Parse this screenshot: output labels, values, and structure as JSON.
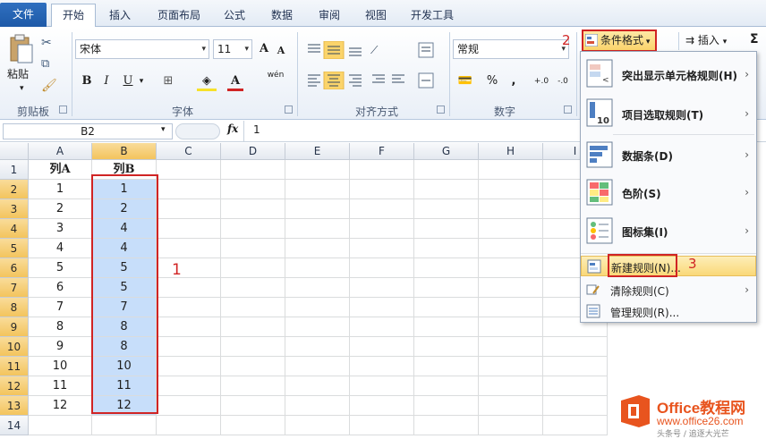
{
  "tabs": [
    "文件",
    "开始",
    "插入",
    "页面布局",
    "公式",
    "数据",
    "审阅",
    "视图",
    "开发工具"
  ],
  "clipboard": {
    "paste": "粘贴",
    "group": "剪贴板"
  },
  "font": {
    "name": "宋体",
    "size": "11",
    "group": "字体",
    "bold": "B",
    "italic": "I",
    "underline": "U",
    "grow": "A",
    "shrink": "A",
    "color_a": "A",
    "wen": "wén"
  },
  "align": {
    "group": "对齐方式"
  },
  "number": {
    "format": "常规",
    "group": "数字",
    "pct": "%",
    "comma": ",",
    "inc": "+.0",
    "dec": "-.0"
  },
  "styles": {
    "cond_format": "条件格式",
    "insert": "插入",
    "sigma": "Σ"
  },
  "formula_bar": {
    "namebox": "B2",
    "fx": "fx",
    "value": "1"
  },
  "columns": [
    "A",
    "B",
    "C",
    "D",
    "E",
    "F",
    "G",
    "H",
    "I"
  ],
  "rows": [
    "1",
    "2",
    "3",
    "4",
    "5",
    "6",
    "7",
    "8",
    "9",
    "10",
    "11",
    "12",
    "13",
    "14"
  ],
  "headers": {
    "a": "列A",
    "b": "列B"
  },
  "col_a": [
    "1",
    "2",
    "3",
    "4",
    "5",
    "6",
    "7",
    "8",
    "9",
    "10",
    "11",
    "12"
  ],
  "col_b": [
    "1",
    "2",
    "4",
    "4",
    "5",
    "5",
    "7",
    "8",
    "8",
    "10",
    "11",
    "12"
  ],
  "menu": {
    "items": [
      {
        "label": "突出显示单元格规则(H)",
        "icon": "highlight-rules-icon"
      },
      {
        "label": "项目选取规则(T)",
        "icon": "top-bottom-rules-icon"
      },
      {
        "label": "数据条(D)",
        "icon": "data-bars-icon"
      },
      {
        "label": "色阶(S)",
        "icon": "color-scales-icon"
      },
      {
        "label": "图标集(I)",
        "icon": "icon-sets-icon"
      }
    ],
    "new_rule": "新建规则(N)...",
    "clear_rules": "清除规则(C)",
    "manage_rules": "管理规则(R)..."
  },
  "annotations": {
    "one": "1",
    "two": "2",
    "three": "3"
  },
  "watermark": {
    "line1": "Office教程网",
    "line2": "www.office26.com",
    "line3": "头条号 / 追逐大光芒",
    "brand_color": "#e8541e"
  },
  "colors": {
    "selection": "#c7defa",
    "highlight": "#fbd46b",
    "annotation": "#d02424",
    "file_tab": "#1e5aa8"
  }
}
